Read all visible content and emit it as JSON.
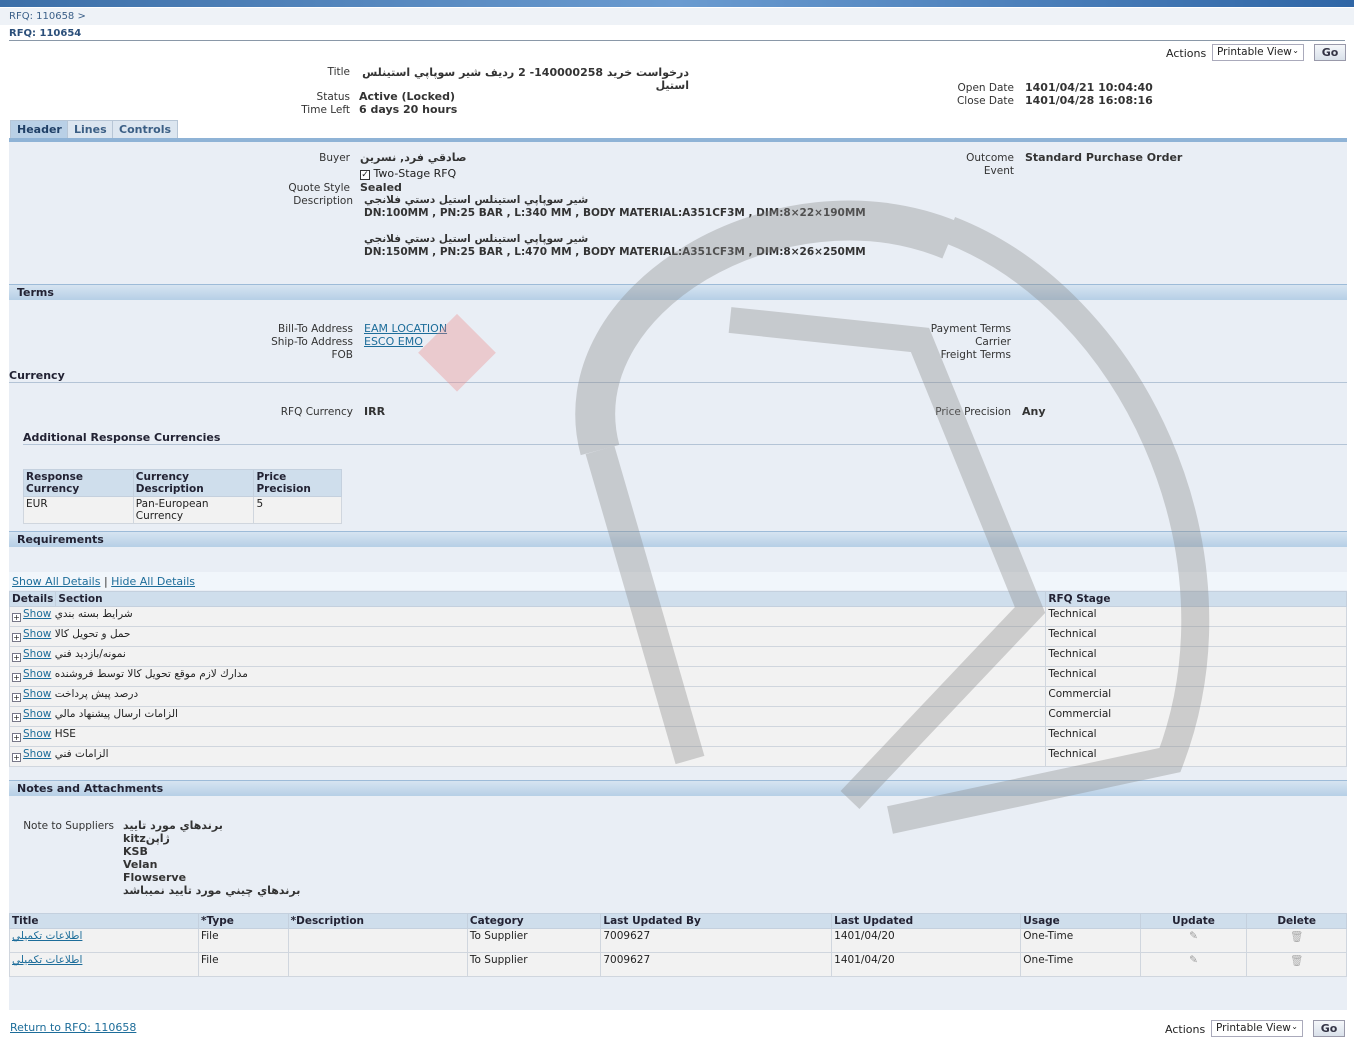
{
  "breadcrumb": {
    "parent": "RFQ: 110658",
    "separator": ">",
    "current": "RFQ: 110654"
  },
  "actions": {
    "label": "Actions",
    "selected": "Printable View",
    "go": "Go"
  },
  "summary": {
    "title_label": "Title",
    "title": "درخواست خريد 140000258- 2 رديف شير سوپاپي استينلس استيل",
    "status_label": "Status",
    "status": "Active (Locked)",
    "time_left_label": "Time Left",
    "time_left": "6 days 20 hours",
    "open_date_label": "Open Date",
    "open_date": "1401/04/21 10:04:40",
    "close_date_label": "Close Date",
    "close_date": "1401/04/28 16:08:16"
  },
  "tabs": [
    "Header",
    "Lines",
    "Controls"
  ],
  "header": {
    "buyer_label": "Buyer",
    "buyer": "صادقي فرد, نسرين",
    "two_stage": "Two-Stage RFQ",
    "two_stage_checked": true,
    "quote_style_label": "Quote Style",
    "quote_style": "Sealed",
    "description_label": "Description",
    "description": [
      "شير سوپاپي استينلس استيل  دستي فلانجي",
      "DN:100MM , PN:25 BAR  , L:340 MM , BODY MATERIAL:A351CF3M  ,  DIM:8×22×190MM",
      "شير سوپاپي استينلس استيل  دستي فلانجي",
      "DN:150MM , PN:25 BAR  , L:470 MM , BODY MATERIAL:A351CF3M  ,  DIM:8×26×250MM"
    ],
    "outcome_label": "Outcome",
    "outcome": "Standard Purchase Order",
    "event_label": "Event"
  },
  "terms": {
    "title": "Terms",
    "bill_to_label": "Bill-To Address",
    "bill_to": "EAM LOCATION",
    "ship_to_label": "Ship-To Address",
    "ship_to": "ESCO EMO",
    "fob_label": "FOB",
    "payment_terms_label": "Payment Terms",
    "carrier_label": "Carrier",
    "freight_terms_label": "Freight Terms"
  },
  "currency": {
    "title": "Currency",
    "rfq_currency_label": "RFQ Currency",
    "rfq_currency": "IRR",
    "price_precision_label": "Price Precision",
    "price_precision": "Any",
    "additional_title": "Additional Response Currencies",
    "columns": [
      "Response Currency",
      "Currency Description",
      "Price Precision"
    ],
    "rows": [
      [
        "EUR",
        "Pan-European Currency",
        "5"
      ]
    ]
  },
  "requirements": {
    "title": "Requirements",
    "show_all": "Show All Details",
    "hide_all": "Hide All Details",
    "columns": [
      "Details",
      "Section",
      "RFQ Stage"
    ],
    "show_label": "Show",
    "rows": [
      [
        "شرايط بسته بندي",
        "Technical"
      ],
      [
        "حمل و تحويل كالا",
        "Technical"
      ],
      [
        "نمونه/بازديد فني",
        "Technical"
      ],
      [
        "مدارك لازم موقع تحويل كالا توسط فروشنده",
        "Technical"
      ],
      [
        "درصد پيش پرداخت",
        "Commercial"
      ],
      [
        "الزامات ارسال پيشنهاد مالي",
        "Commercial"
      ],
      [
        "HSE",
        "Technical"
      ],
      [
        "الزامات فني",
        "Technical"
      ]
    ]
  },
  "notes": {
    "title": "Notes and Attachments",
    "note_label": "Note to Suppliers",
    "note_lines": [
      "برندهاي مورد تاييد",
      "kitzژاپن",
      "KSB",
      "Velan",
      "Flowserve",
      "برندهاي چيني مورد تاييد نميباشد"
    ],
    "columns": [
      "Title",
      "*Type",
      "*Description",
      "Category",
      "Last Updated By",
      "Last Updated",
      "Usage",
      "Update",
      "Delete"
    ],
    "rows": [
      [
        "اطلاعات تكميلي",
        "File",
        "",
        "To Supplier",
        "7009627",
        "1401/04/20",
        "One-Time"
      ],
      [
        "اطلاعات تكميلي",
        "File",
        "",
        "To Supplier",
        "7009627",
        "1401/04/20",
        "One-Time"
      ]
    ]
  },
  "footer": {
    "return_link": "Return to RFQ: 110658"
  },
  "colors": {
    "accent": "#8fb3d6",
    "panel": "#e9eef5",
    "link": "#1d6d9a"
  }
}
